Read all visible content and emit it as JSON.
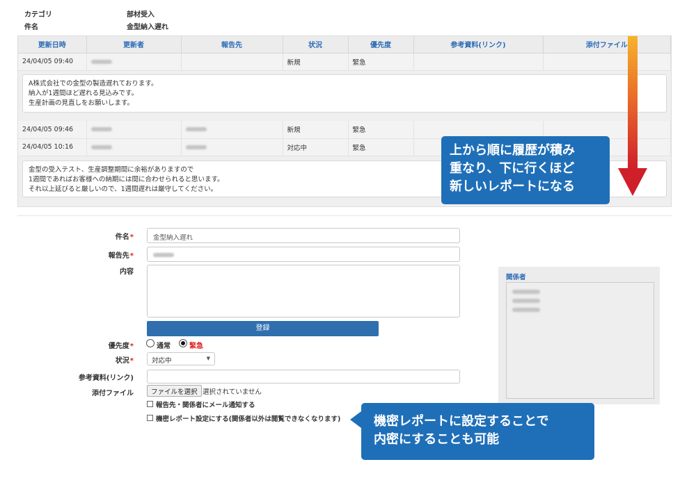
{
  "meta": {
    "category_label": "カテゴリ",
    "category_value": "部材受入",
    "subject_label": "件名",
    "subject_value": "金型納入遅れ"
  },
  "history": {
    "columns": [
      "更新日時",
      "更新者",
      "報告先",
      "状況",
      "優先度",
      "参考資料(リンク)",
      "添付ファイル"
    ],
    "entries": [
      {
        "datetime": "24/04/05 09:40",
        "status": "新規",
        "priority": "緊急",
        "message": [
          "A株式会社での金型の製造遅れております。",
          "納入が1週間ほど遅れる見込みです。",
          "生産計画の見直しをお願いします。"
        ]
      },
      {
        "datetime": "24/04/05 09:46",
        "status": "新規",
        "priority": "緊急"
      },
      {
        "datetime": "24/04/05 10:16",
        "status": "対応中",
        "priority": "緊急",
        "message": [
          "金型の受入テスト、生産調整期間に余裕がありますので",
          "1週間であればお客様への納期には間に合わせられると思います。",
          "それ以上延びると厳しいので、1週間遅れは厳守してください。"
        ]
      }
    ]
  },
  "form": {
    "subject_label": "件名",
    "subject_value": "金型納入遅れ",
    "report_to_label": "報告先",
    "content_label": "内容",
    "register_button": "登録",
    "priority_label": "優先度",
    "priority_options": [
      "通常",
      "緊急"
    ],
    "priority_selected": "緊急",
    "status_label": "状況",
    "status_value": "対応中",
    "link_label": "参考資料(リンク)",
    "attachment_label": "添付ファイル",
    "file_button": "ファイルを選択",
    "file_status": "選択されていません",
    "notify_checkbox": "報告先・関係者にメール通知する",
    "confidential_checkbox": "機密レポート設定にする(関係者以外は閲覧できなくなります)"
  },
  "related": {
    "title": "関係者"
  },
  "callouts": {
    "history_order": [
      "上から順に履歴が積み",
      "重なり、下に行くほど",
      "新しいレポートになる"
    ],
    "confidential": [
      "機密レポートに設定することで",
      "内密にすることも可能"
    ]
  },
  "colors": {
    "accent": "#2b6cb5",
    "callout": "#1f6fb8",
    "required": "#e02020",
    "button": "#2f6fae"
  }
}
